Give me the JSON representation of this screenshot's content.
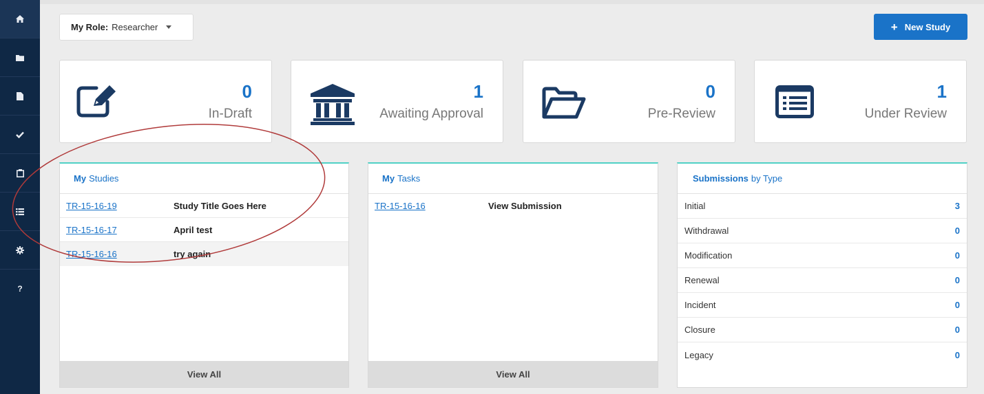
{
  "sidebar": {
    "items": [
      {
        "icon": "home-icon"
      },
      {
        "icon": "folder-icon"
      },
      {
        "icon": "document-icon"
      },
      {
        "icon": "check-icon"
      },
      {
        "icon": "clipboard-icon"
      },
      {
        "icon": "list-icon"
      },
      {
        "icon": "gear-icon"
      },
      {
        "icon": "help-icon",
        "label": "?"
      }
    ]
  },
  "role": {
    "label": "My Role:",
    "value": "Researcher"
  },
  "new_study": {
    "label": "New Study"
  },
  "stats": [
    {
      "count": "0",
      "label": "In-Draft",
      "icon": "edit-icon"
    },
    {
      "count": "1",
      "label": "Awaiting Approval",
      "icon": "institution-icon"
    },
    {
      "count": "0",
      "label": "Pre-Review",
      "icon": "folder-open-icon"
    },
    {
      "count": "1",
      "label": "Under Review",
      "icon": "list-alt-icon"
    }
  ],
  "studies": {
    "title_bold": "My",
    "title_rest": "Studies",
    "rows": [
      {
        "id": "TR-15-16-19",
        "title": "Study Title Goes Here"
      },
      {
        "id": "TR-15-16-17",
        "title": "April test"
      },
      {
        "id": "TR-15-16-16",
        "title": "try again"
      }
    ],
    "view_all": "View All"
  },
  "tasks": {
    "title_bold": "My",
    "title_rest": "Tasks",
    "rows": [
      {
        "id": "TR-15-16-16",
        "title": "View Submission"
      }
    ],
    "view_all": "View All"
  },
  "submissions": {
    "title_bold": "Submissions",
    "title_rest": "by Type",
    "rows": [
      {
        "type": "Initial",
        "count": "3"
      },
      {
        "type": "Withdrawal",
        "count": "0"
      },
      {
        "type": "Modification",
        "count": "0"
      },
      {
        "type": "Renewal",
        "count": "0"
      },
      {
        "type": "Incident",
        "count": "0"
      },
      {
        "type": "Closure",
        "count": "0"
      },
      {
        "type": "Legacy",
        "count": "0"
      }
    ]
  },
  "colors": {
    "accent": "#1a73c8",
    "sidebar": "#0f2845",
    "panel_border": "#4fd1c5",
    "annotation": "#b03a3a"
  }
}
